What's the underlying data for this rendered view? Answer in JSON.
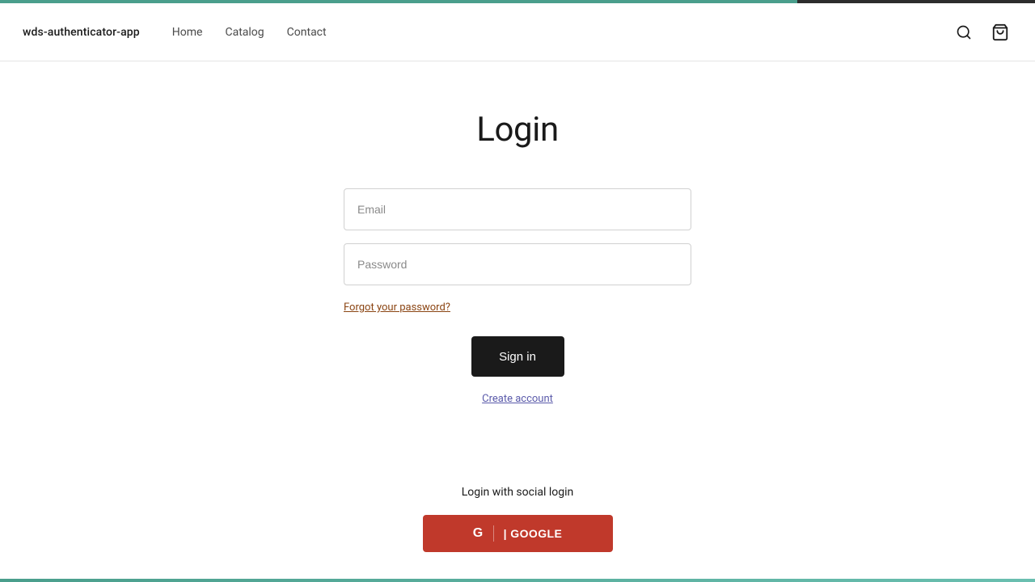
{
  "topbar": {
    "progress_width": "77%"
  },
  "navbar": {
    "brand": "wds-authenticator-app",
    "links": [
      {
        "label": "Home",
        "id": "home"
      },
      {
        "label": "Catalog",
        "id": "catalog"
      },
      {
        "label": "Contact",
        "id": "contact"
      }
    ]
  },
  "page": {
    "title": "Login"
  },
  "form": {
    "email_placeholder": "Email",
    "password_placeholder": "Password",
    "forgot_label": "Forgot your password?",
    "sign_in_label": "Sign in",
    "create_account_label": "Create account"
  },
  "social": {
    "title": "Login with social login",
    "google_label": "| GOOGLE",
    "google_g": "G"
  }
}
